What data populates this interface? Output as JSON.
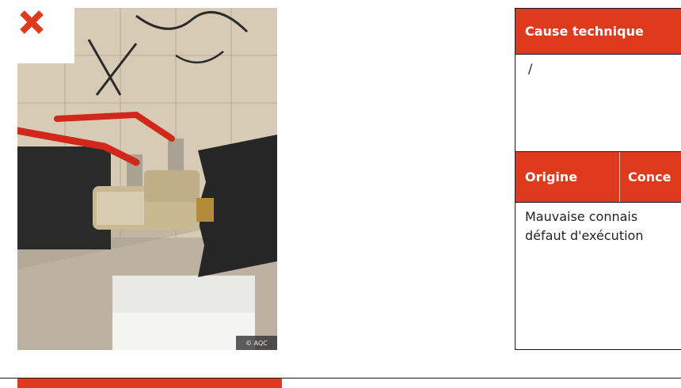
{
  "photo": {
    "status_icon": "close-icon",
    "status_color": "#e03a1e",
    "credit": "© AQC"
  },
  "info": {
    "header_cause": "Cause technique",
    "cause_value": "/",
    "header_origine": "Origine",
    "header_conce": "Conce",
    "origine_line1": "Mauvaise connais",
    "origine_line2": "défaut d'exécution"
  },
  "accent_color": "#e03a1e"
}
